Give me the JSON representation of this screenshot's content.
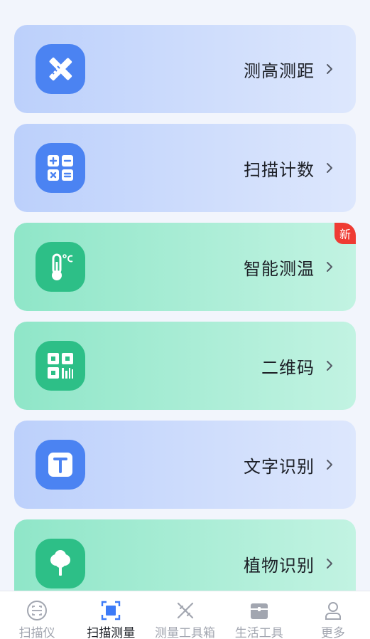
{
  "cards": [
    {
      "label": "测高测距",
      "icon": "ruler-pencil-icon",
      "theme": "blue"
    },
    {
      "label": "扫描计数",
      "icon": "calculator-icon",
      "theme": "blue"
    },
    {
      "label": "智能测温",
      "icon": "thermometer-icon",
      "theme": "green",
      "badge": "新"
    },
    {
      "label": "二维码",
      "icon": "qr-code-icon",
      "theme": "green"
    },
    {
      "label": "文字识别",
      "icon": "text-recognition-icon",
      "theme": "blue"
    },
    {
      "label": "植物识别",
      "icon": "tree-icon",
      "theme": "green"
    }
  ],
  "tabs": [
    {
      "label": "扫描仪",
      "icon": "scanner-icon",
      "active": false
    },
    {
      "label": "扫描测量",
      "icon": "scan-measure-icon",
      "active": true
    },
    {
      "label": "测量工具箱",
      "icon": "tools-icon",
      "active": false
    },
    {
      "label": "生活工具",
      "icon": "toolbox-icon",
      "active": false
    },
    {
      "label": "更多",
      "icon": "person-icon",
      "active": false
    }
  ],
  "colors": {
    "blue_accent": "#4b83f2",
    "green_accent": "#2dbf87",
    "badge": "#ef3b33",
    "active_tab": "#3d7bf7"
  }
}
